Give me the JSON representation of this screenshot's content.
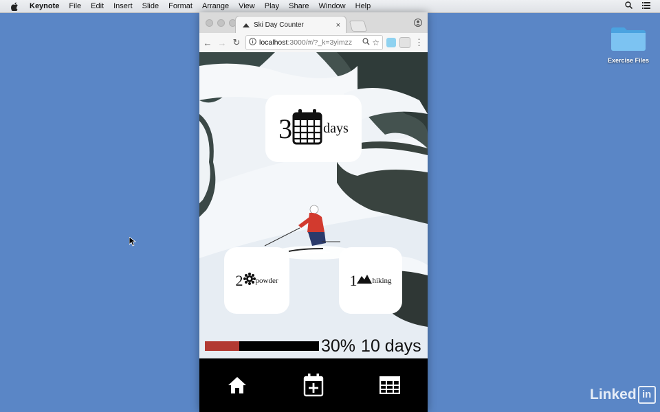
{
  "menubar": {
    "app": "Keynote",
    "items": [
      "File",
      "Edit",
      "Insert",
      "Slide",
      "Format",
      "Arrange",
      "View",
      "Play",
      "Share",
      "Window",
      "Help"
    ],
    "icons": [
      "apple-icon",
      "search-icon",
      "list-icon"
    ]
  },
  "desktop": {
    "folder_label": "Exercise Files"
  },
  "browser": {
    "tab_title": "Ski Day Counter",
    "tab_close": "×",
    "url_host": "localhost",
    "url_rest": ":3000/#/?_k=3yimzz"
  },
  "app": {
    "total": {
      "value": "3",
      "unit": "days"
    },
    "powder": {
      "value": "2",
      "unit": "powder"
    },
    "backcountry": {
      "value": "1",
      "unit": "hiking"
    },
    "progress": {
      "fraction": 0.3,
      "percent_label": "30%",
      "goal_label": "10 days"
    },
    "nav": [
      "home-icon",
      "add-day-icon",
      "list-days-icon"
    ],
    "colors": {
      "progress_fill": "#b23a32",
      "progress_track": "#000000",
      "nav_bg": "#000000"
    }
  },
  "watermark": {
    "text": "Linked",
    "badge": "in"
  }
}
